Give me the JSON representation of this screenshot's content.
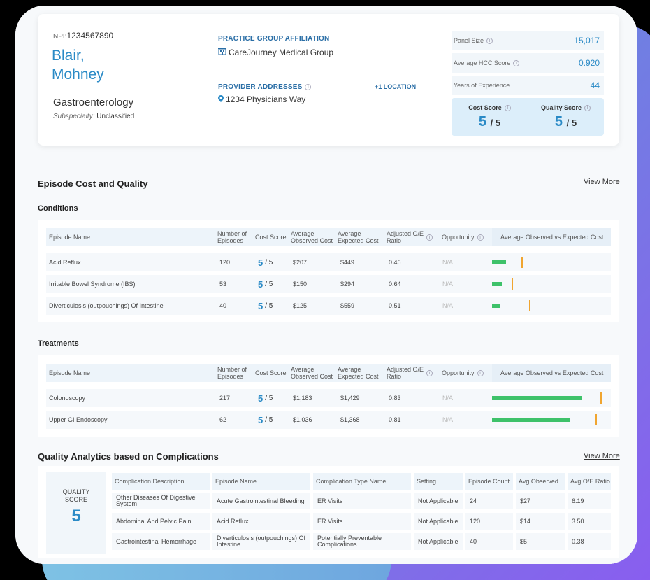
{
  "provider": {
    "npi_label": "NPI:",
    "npi": "1234567890",
    "name_line1": "Blair,",
    "name_line2": "Mohney",
    "specialty": "Gastroenterology",
    "subspecialty_label": "Subspecialty:",
    "subspecialty": "Unclassified",
    "practice_group_label": "PRACTICE GROUP AFFILIATION",
    "practice_group": "CareJourney Medical Group",
    "addresses_label": "PROVIDER ADDRESSES",
    "address": "1234 Physicians Way",
    "more_locations": "+1 LOCATION"
  },
  "stats": [
    {
      "label": "Panel Size",
      "value": "15,017"
    },
    {
      "label": "Average HCC Score",
      "value": "0.920"
    },
    {
      "label": "Years of Experience",
      "value": "44"
    }
  ],
  "scores": {
    "cost_label": "Cost Score",
    "cost_value": "5",
    "quality_label": "Quality Score",
    "quality_value": "5",
    "denominator": "/ 5"
  },
  "episode_section": {
    "title": "Episode Cost and Quality",
    "view_more": "View More",
    "conditions_title": "Conditions",
    "treatments_title": "Treatments"
  },
  "columns": {
    "episode_name": "Episode Name",
    "num_episodes_1": "Number of",
    "num_episodes_2": "Episodes",
    "cost_score": "Cost Score",
    "avg_observed_1": "Average",
    "avg_observed_2": "Observed Cost",
    "avg_expected_1": "Average",
    "avg_expected_2": "Expected Cost",
    "adj_ratio_1": "Adjusted O/E",
    "adj_ratio_2": "Ratio",
    "opportunity": "Opportunity",
    "chart": "Average Observed vs Expected Cost"
  },
  "conditions": [
    {
      "name": "Acid Reflux",
      "episodes": "120",
      "score": "5",
      "observed": "$207",
      "expected": "$449",
      "ratio": "0.46",
      "opportunity": "N/A",
      "obs_val": 207,
      "exp_val": 449
    },
    {
      "name": "Irritable Bowel Syndrome (IBS)",
      "episodes": "53",
      "score": "5",
      "observed": "$150",
      "expected": "$294",
      "ratio": "0.64",
      "opportunity": "N/A",
      "obs_val": 150,
      "exp_val": 294
    },
    {
      "name": "Diverticulosis (outpouchings) Of Intestine",
      "episodes": "40",
      "score": "5",
      "observed": "$125",
      "expected": "$559",
      "ratio": "0.51",
      "opportunity": "N/A",
      "obs_val": 125,
      "exp_val": 559
    }
  ],
  "treatments": [
    {
      "name": "Colonoscopy",
      "episodes": "217",
      "score": "5",
      "observed": "$1,183",
      "expected": "$1,429",
      "ratio": "0.83",
      "opportunity": "N/A",
      "obs_val": 1183,
      "exp_val": 1429
    },
    {
      "name": "Upper GI Endoscopy",
      "episodes": "62",
      "score": "5",
      "observed": "$1,036",
      "expected": "$1,368",
      "ratio": "0.81",
      "opportunity": "N/A",
      "obs_val": 1036,
      "exp_val": 1368
    }
  ],
  "quality_section": {
    "title": "Quality Analytics based on Complications",
    "view_more": "View More",
    "score_label_1": "QUALITY",
    "score_label_2": "SCORE",
    "score_value": "5",
    "headers": [
      "Complication Description",
      "Episode Name",
      "Complication Type Name",
      "Setting",
      "Episode Count",
      "Avg Observed",
      "Avg O/E Ratio"
    ],
    "rows": [
      [
        "Other Diseases Of Digestive System",
        "Acute Gastrointestinal Bleeding",
        "ER Visits",
        "Not Applicable",
        "24",
        "$27",
        "6.19"
      ],
      [
        "Abdominal And Pelvic Pain",
        "Acid Reflux",
        "ER Visits",
        "Not Applicable",
        "120",
        "$14",
        "3.50"
      ],
      [
        "Gastrointestinal Hemorrhage",
        "Diverticulosis (outpouchings) Of Intestine",
        "Potentially Preventable Complications",
        "Not Applicable",
        "40",
        "$5",
        "0.38"
      ]
    ]
  },
  "colors": {
    "accent": "#2a8ac6",
    "bar_observed": "#3ec26a",
    "bar_expected": "#f0a530"
  }
}
